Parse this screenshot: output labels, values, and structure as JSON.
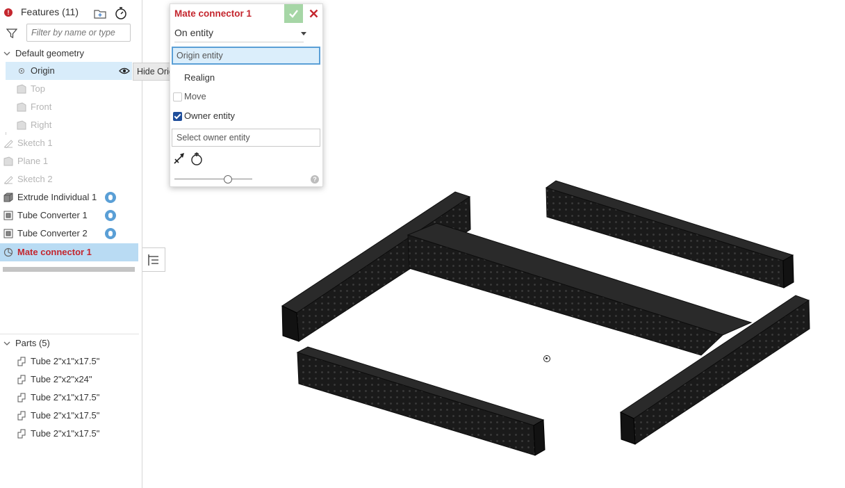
{
  "feature_panel": {
    "title": "Features (11)",
    "filter_placeholder": "Filter by name or type",
    "default_geometry": {
      "label": "Default geometry",
      "items": [
        {
          "label": "Origin",
          "selected": true
        },
        {
          "label": "Top"
        },
        {
          "label": "Front"
        },
        {
          "label": "Right"
        }
      ]
    },
    "features": [
      {
        "label": "Sketch 1",
        "icon": "sketch-icon",
        "dimmed": true
      },
      {
        "label": "Plane 1",
        "icon": "plane-icon",
        "dimmed": true
      },
      {
        "label": "Sketch 2",
        "icon": "sketch-icon",
        "dimmed": true
      },
      {
        "label": "Extrude Individual 1",
        "icon": "extrude-icon",
        "dimmed": false
      },
      {
        "label": "Tube Converter 1",
        "icon": "tube-converter-icon",
        "dimmed": false
      },
      {
        "label": "Tube Converter 2",
        "icon": "tube-converter-icon",
        "dimmed": false
      },
      {
        "label": "Mate connector 1",
        "icon": "mate-connector-icon",
        "active": true
      }
    ],
    "hide_origin_tooltip": "Hide Origin",
    "parts": {
      "label": "Parts (5)",
      "items": [
        {
          "label": "Tube 2\"x1\"x17.5\""
        },
        {
          "label": "Tube 2\"x2\"x24\""
        },
        {
          "label": "Tube 2\"x1\"x17.5\""
        },
        {
          "label": "Tube 2\"x1\"x17.5\""
        },
        {
          "label": "Tube 2\"x1\"x17.5\""
        }
      ]
    }
  },
  "dialog": {
    "title": "Mate connector 1",
    "placement_option": "On entity",
    "origin_entity_label": "Origin entity",
    "realign_label": "Realign",
    "move_label": "Move",
    "owner_entity_label": "Owner entity",
    "owner_entity_checked": true,
    "select_owner_placeholder": "Select owner entity",
    "help_glyph": "?"
  },
  "colors": {
    "accent_red": "#c4262e",
    "selection_blue": "#b9dbf3",
    "confirm_green": "#a6d6a6",
    "info_blue": "#5a9fd6"
  }
}
